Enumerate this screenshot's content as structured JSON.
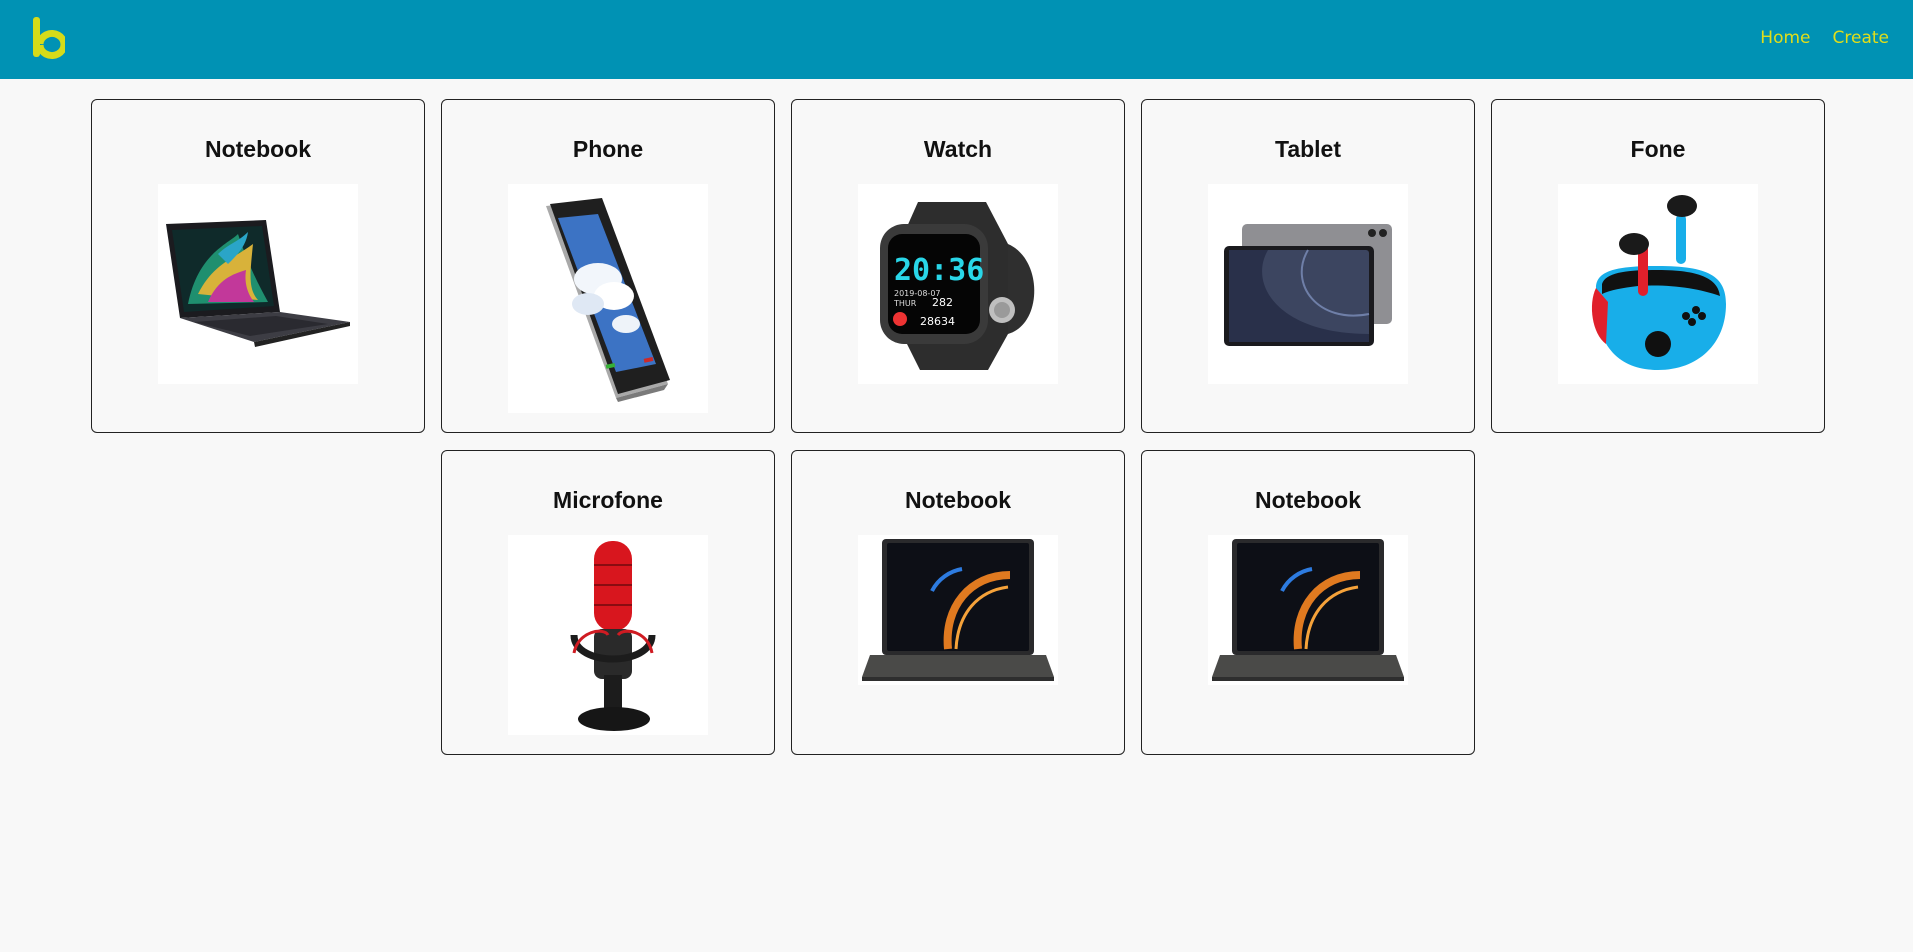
{
  "header": {
    "logo_icon": "b-logo-icon",
    "nav": [
      {
        "label": "Home"
      },
      {
        "label": "Create"
      }
    ],
    "colors": {
      "bar": "#0092b4",
      "accent": "#e1de1a"
    }
  },
  "products": [
    {
      "title": "Notebook",
      "icon": "laptop-colorful-icon"
    },
    {
      "title": "Phone",
      "icon": "smartphone-icon"
    },
    {
      "title": "Watch",
      "icon": "smartwatch-icon"
    },
    {
      "title": "Tablet",
      "icon": "tablet-icon"
    },
    {
      "title": "Fone",
      "icon": "earbuds-icon"
    },
    {
      "title": "Microfone",
      "icon": "microphone-icon"
    },
    {
      "title": "Notebook",
      "icon": "laptop-dark-icon"
    },
    {
      "title": "Notebook",
      "icon": "laptop-dark-icon"
    }
  ]
}
